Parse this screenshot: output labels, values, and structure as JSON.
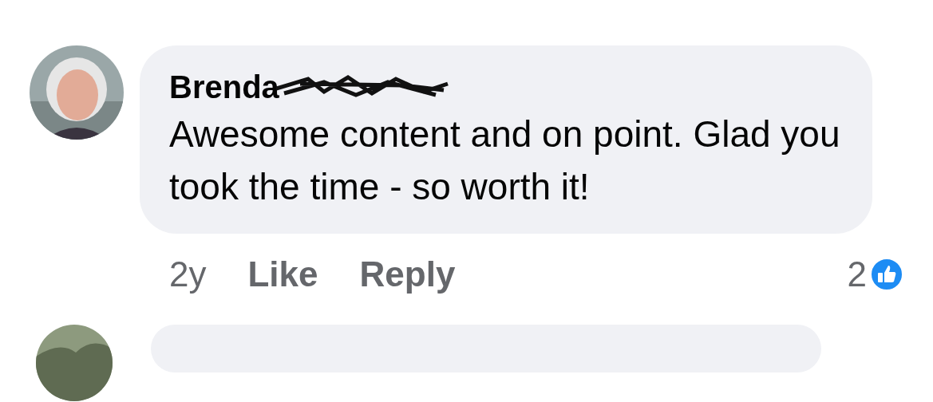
{
  "comment": {
    "author": "Brenda",
    "text": "Awesome content and on point. Glad you took the time - so worth it!",
    "time": "2y",
    "actions": [
      "Like",
      "Reply"
    ],
    "reaction_count": "2"
  }
}
